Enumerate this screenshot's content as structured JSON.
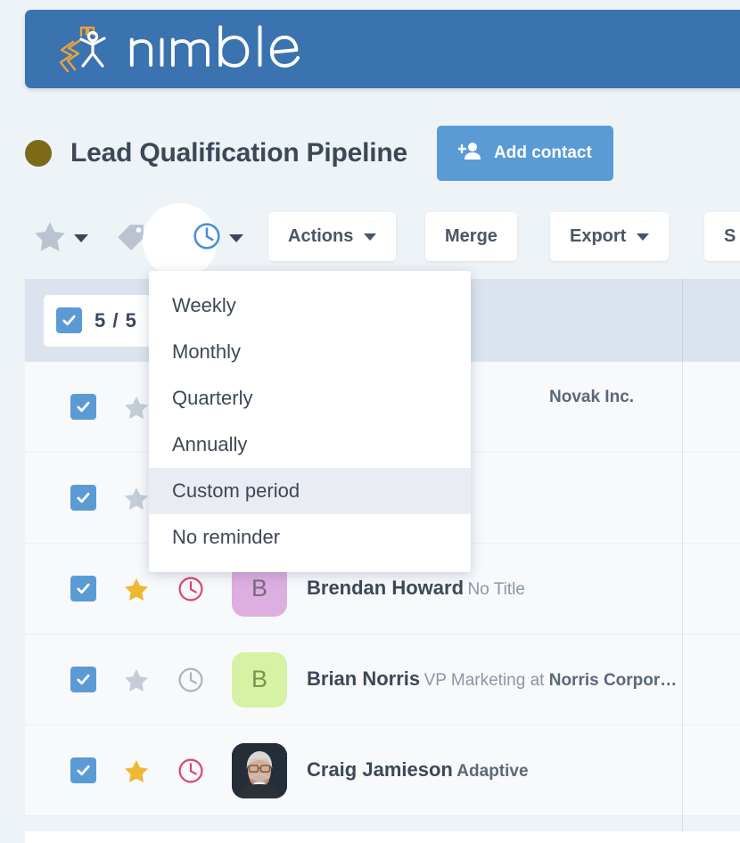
{
  "brand": {
    "name": "nimble",
    "bar_color": "#3b73b0",
    "logo_icon": "nimble-runner-logo"
  },
  "header": {
    "pipeline_dot_color": "#7d6a16",
    "title": "Lead Qualification Pipeline",
    "add_contact_label": "Add contact",
    "add_contact_icon": "add-person-icon",
    "add_contact_color": "#5b9bd5"
  },
  "toolbar": {
    "icons": [
      {
        "name": "star-icon",
        "state": "inactive"
      },
      {
        "name": "tag-icon",
        "state": "inactive"
      },
      {
        "name": "clock-icon",
        "state": "active"
      }
    ],
    "buttons": [
      {
        "label": "Actions",
        "has_caret": true
      },
      {
        "label": "Merge",
        "has_caret": false
      },
      {
        "label": "Export",
        "has_caret": true
      },
      {
        "label": "S",
        "has_caret": false
      }
    ]
  },
  "reminder_menu": {
    "open": true,
    "items": [
      {
        "label": "Weekly",
        "highlighted": false
      },
      {
        "label": "Monthly",
        "highlighted": false
      },
      {
        "label": "Quarterly",
        "highlighted": false
      },
      {
        "label": "Annually",
        "highlighted": false
      },
      {
        "label": "Custom period",
        "highlighted": true
      },
      {
        "label": "No reminder",
        "highlighted": false
      }
    ]
  },
  "table": {
    "selection": {
      "checked": true,
      "count_label": "5 / 5"
    },
    "rows": [
      {
        "checked": true,
        "starred": false,
        "reminder": "inactive",
        "avatar": {
          "type": "initial",
          "initial": "",
          "bg": "#f7f9fb",
          "fg": "#f7f9fb"
        },
        "name": "",
        "subtitle": "Novak Inc.",
        "subtitle_strong": true,
        "obscured": true
      },
      {
        "checked": true,
        "starred": false,
        "reminder": "inactive",
        "avatar": {
          "type": "initial",
          "initial": "",
          "bg": "#f7f9fb",
          "fg": "#f7f9fb"
        },
        "name": "",
        "subtitle": "",
        "subtitle_strong": false,
        "obscured": true
      },
      {
        "checked": true,
        "starred": true,
        "reminder": "active",
        "avatar": {
          "type": "initial",
          "initial": "B",
          "bg": "#ddadE2",
          "fg": "#7b6b80"
        },
        "name": "Brendan Howard",
        "subtitle": "No Title",
        "subtitle_strong": false,
        "obscured": false
      },
      {
        "checked": true,
        "starred": false,
        "reminder": "inactive",
        "avatar": {
          "type": "initial",
          "initial": "B",
          "bg": "#d6f2a4",
          "fg": "#7d9150"
        },
        "name": "Brian Norris",
        "subtitle_prefix": "VP Marketing at ",
        "subtitle_company": "Norris Corpor…",
        "subtitle": "VP Marketing at Norris Corpor…",
        "subtitle_strong": false,
        "obscured": false
      },
      {
        "checked": true,
        "starred": true,
        "reminder": "active",
        "avatar": {
          "type": "photo",
          "initial": "",
          "bg": "#232a33",
          "fg": "#ffffff"
        },
        "name": "Craig Jamieson",
        "subtitle": "Adaptive",
        "subtitle_strong": true,
        "obscured": false
      }
    ]
  },
  "colors": {
    "page_bg": "#eef3f8",
    "row_bg": "#f7f9fb",
    "header_bg": "#dbe4ee",
    "accent_blue": "#5b9bd5",
    "star_gold": "#f0b832",
    "star_gray": "#b9c4d0",
    "clock_red": "#e0436b",
    "clock_gray": "#a8b4c2",
    "text_dark": "#3c4858",
    "text_muted": "#8a97a8"
  }
}
